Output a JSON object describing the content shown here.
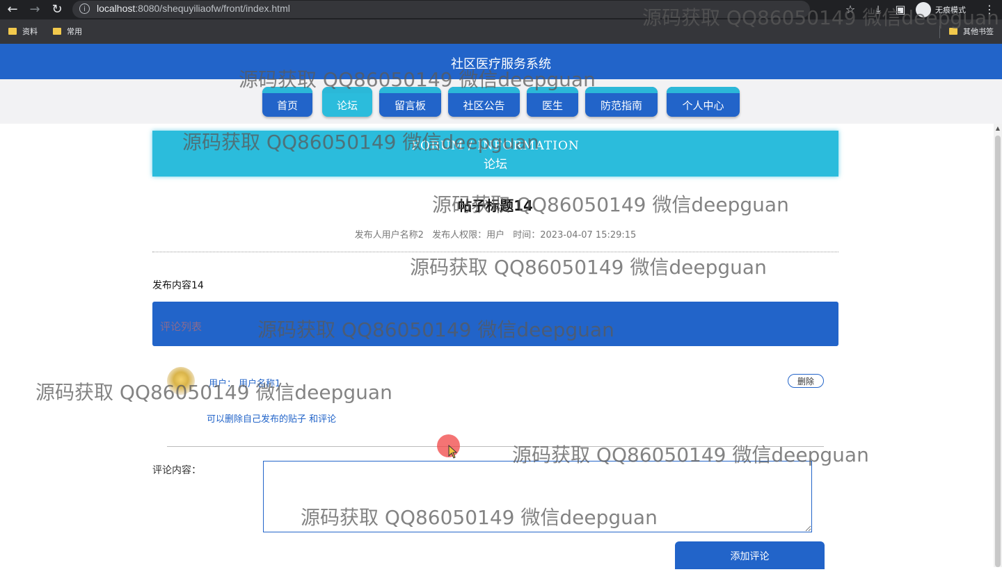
{
  "browser": {
    "url_host": "localhost",
    "url_rest": ":8080/shequyiliaofw/front/index.html",
    "incognito_label": "无痕模式",
    "bookmarks": [
      "资料",
      "常用"
    ],
    "other_bookmarks": "其他书签"
  },
  "site": {
    "title": "社区医疗服务系统",
    "nav": [
      {
        "label": "首页",
        "active": false
      },
      {
        "label": "论坛",
        "active": true
      },
      {
        "label": "留言板",
        "active": false
      },
      {
        "label": "社区公告",
        "active": false
      },
      {
        "label": "医生",
        "active": false
      },
      {
        "label": "防范指南",
        "active": false
      },
      {
        "label": "个人中心",
        "active": false
      }
    ]
  },
  "banner": {
    "en": "FORUM / INFORMATION",
    "zh": "论坛"
  },
  "post": {
    "title": "帖子标题14",
    "author": "发布人用户名称2",
    "role": "发布人权限：用户",
    "time": "时间：2023-04-07 15:29:15",
    "content": "发布内容14"
  },
  "comments": {
    "header": "评论列表",
    "items": [
      {
        "user_label": "用户：",
        "user_name": "用户名称1",
        "delete_label": "删除",
        "text": "可以删除自己发布的贴子 和评论"
      }
    ]
  },
  "form": {
    "label": "评论内容：",
    "textarea_value": "",
    "submit_label": "添加评论"
  },
  "watermark": "源码获取 QQ86050149 微信deepguan",
  "colors": {
    "primary": "#2264c9",
    "accent": "#2bbcdc"
  }
}
